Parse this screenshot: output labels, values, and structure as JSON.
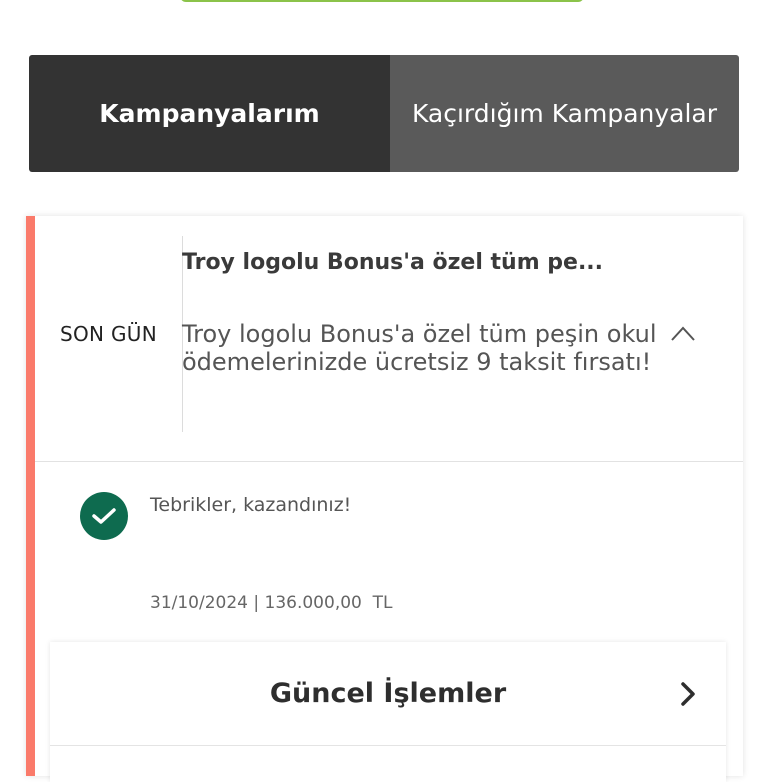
{
  "tabs": {
    "active_label": "Kampanyalarım",
    "inactive_label": "Kaçırdığım Kampanyalar"
  },
  "campaign": {
    "badge": "SON GÜN",
    "title": "Troy logolu Bonus'a özel tüm pe...",
    "description": "Troy logolu Bonus'a özel tüm peşin okul ödemelerinizde ücretsiz 9 taksit fırsatı!",
    "status_text": "Tebrikler, kazandınız!",
    "info_line": "31/10/2024 | 136.000,00  TL",
    "accent_color": "#fa7a6a",
    "success_color": "#0e6b4f"
  },
  "transactions": {
    "title": "Güncel İşlemler"
  },
  "icons": {
    "expand": "chevron-up-icon",
    "success": "check-circle-icon",
    "navigate": "chevron-right-icon"
  }
}
